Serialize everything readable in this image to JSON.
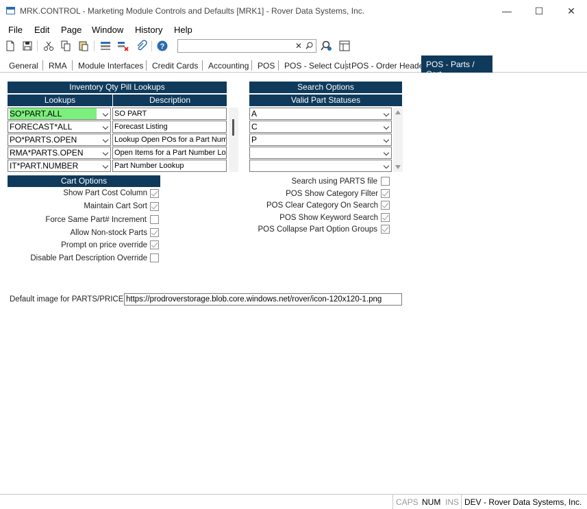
{
  "window": {
    "title": "MRK.CONTROL - Marketing Module Controls and Defaults [MRK1] - Rover Data Systems, Inc."
  },
  "menu": [
    "File",
    "Edit",
    "Page",
    "Window",
    "History",
    "Help"
  ],
  "tabs": [
    {
      "label": "General",
      "active": false
    },
    {
      "label": "RMA",
      "active": false
    },
    {
      "label": "Module Interfaces",
      "active": false
    },
    {
      "label": "Credit Cards",
      "active": false
    },
    {
      "label": "Accounting",
      "active": false
    },
    {
      "label": "POS",
      "active": false
    },
    {
      "label": "POS - Select Cust",
      "active": false
    },
    {
      "label": "POS - Order Header",
      "active": false
    },
    {
      "label": "POS - Parts / Cart",
      "active": true
    }
  ],
  "search": {
    "value": ""
  },
  "inventory": {
    "header": "Inventory Qty Pill Lookups",
    "col_lookups": "Lookups",
    "col_description": "Description",
    "rows": [
      {
        "lookup": "SO*PART.ALL",
        "description": "SO PART"
      },
      {
        "lookup": "FORECAST*ALL",
        "description": "Forecast Listing"
      },
      {
        "lookup": "PO*PARTS.OPEN",
        "description": "Lookup Open POs for a Part Numb"
      },
      {
        "lookup": "RMA*PARTS.OPEN",
        "description": "Open Items for a Part Number Loo"
      },
      {
        "lookup": "IT*PART.NUMBER",
        "description": "Part Number Lookup"
      }
    ]
  },
  "search_options": {
    "header": "Search Options",
    "sub_header": "Valid Part Statuses",
    "statuses": [
      "A",
      "C",
      "P",
      "",
      ""
    ]
  },
  "cart_options": {
    "header": "Cart Options",
    "items": [
      {
        "label": "Show Part Cost Column",
        "checked": true
      },
      {
        "label": "Maintain Cart Sort",
        "checked": true
      },
      {
        "label": "Force Same Part# Increment",
        "checked": false
      },
      {
        "label": "Allow Non-stock Parts",
        "checked": true
      },
      {
        "label": "Prompt on price override",
        "checked": true
      },
      {
        "label": "Disable Part Description Override",
        "checked": false
      }
    ]
  },
  "search_flags": [
    {
      "label": "Search using PARTS file",
      "checked": false
    },
    {
      "label": "POS Show Category Filter",
      "checked": true
    },
    {
      "label": "POS Clear Category On Search",
      "checked": true
    },
    {
      "label": "POS Show Keyword Search",
      "checked": true
    },
    {
      "label": "POS Collapse Part Option Groups",
      "checked": true
    }
  ],
  "default_image": {
    "label": "Default image for PARTS/PRICE",
    "value": "https://prodroverstorage.blob.core.windows.net/rover/icon-120x120-1.png"
  },
  "status": {
    "caps": "CAPS",
    "num": "NUM",
    "ins": "INS",
    "env": "DEV - Rover Data Systems, Inc."
  },
  "colors": {
    "header_bg": "#0f3a5b",
    "highlight": "#7cf07c"
  }
}
